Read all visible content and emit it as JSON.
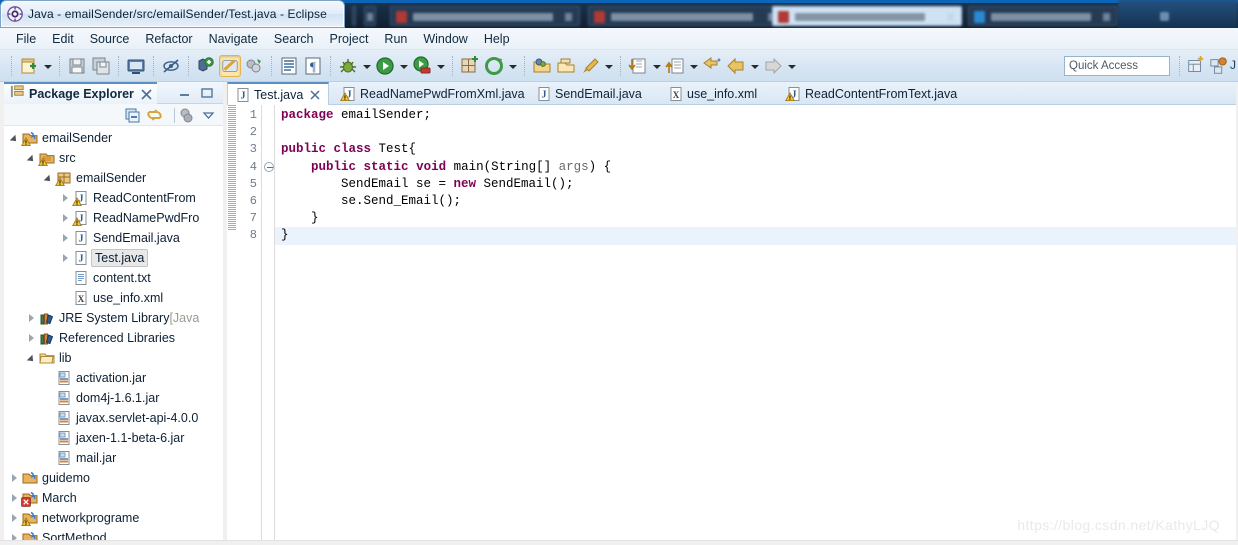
{
  "window": {
    "title": "Java - emailSender/src/emailSender/Test.java - Eclipse",
    "app_icon": "eclipse-icon"
  },
  "background": {
    "tabs": [
      {
        "name": "bg-window-tab-1"
      },
      {
        "name": "bg-window-tab-2"
      },
      {
        "name": "bg-window-tab-3"
      },
      {
        "name": "bg-window-tab-4"
      }
    ]
  },
  "menubar": {
    "items": [
      {
        "label": "File"
      },
      {
        "label": "Edit"
      },
      {
        "label": "Source"
      },
      {
        "label": "Refactor"
      },
      {
        "label": "Navigate"
      },
      {
        "label": "Search"
      },
      {
        "label": "Project"
      },
      {
        "label": "Run"
      },
      {
        "label": "Window"
      },
      {
        "label": "Help"
      }
    ]
  },
  "toolbar": {
    "buttons": [
      {
        "name": "new-wizard-button",
        "icon": "new-file-icon"
      },
      {
        "name": "save-button",
        "icon": "save-icon"
      },
      {
        "name": "save-all-button",
        "icon": "save-all-icon"
      },
      {
        "name": "print-button",
        "icon": "print-icon"
      },
      {
        "name": "toggle-mark-occurrences-button",
        "icon": "mark-occurrences-icon"
      },
      {
        "name": "new-java-class-button",
        "icon": "new-class-icon"
      },
      {
        "name": "open-type-button",
        "icon": "open-type-icon"
      },
      {
        "name": "external-tools-button",
        "icon": "external-tools-icon"
      },
      {
        "name": "toggle-block-selection-button",
        "icon": "block-selection-icon"
      },
      {
        "name": "show-whitespace-button",
        "icon": "pilcrow-icon"
      },
      {
        "name": "debug-button",
        "icon": "debug-bug-icon"
      },
      {
        "name": "run-button",
        "icon": "run-play-icon"
      },
      {
        "name": "coverage-button",
        "icon": "coverage-icon"
      },
      {
        "name": "new-annotation-button",
        "icon": "grid-plus-icon"
      },
      {
        "name": "refresh-button",
        "icon": "refresh-icon"
      },
      {
        "name": "open-task-button",
        "icon": "open-task-icon"
      },
      {
        "name": "close-task-button",
        "icon": "close-task-icon"
      },
      {
        "name": "edit-task-button",
        "icon": "brush-icon"
      },
      {
        "name": "previous-annotation-button",
        "icon": "down-arrow-doc-icon"
      },
      {
        "name": "next-annotation-button",
        "icon": "up-arrow-doc-icon"
      },
      {
        "name": "last-edit-location-button",
        "icon": "last-edit-icon"
      },
      {
        "name": "back-button",
        "icon": "back-arrow-icon"
      },
      {
        "name": "forward-button",
        "icon": "forward-arrow-icon"
      }
    ],
    "quick_access_placeholder": "Quick Access",
    "perspective_buttons": [
      {
        "name": "open-perspective-button",
        "icon": "open-perspective-icon"
      },
      {
        "name": "java-perspective-button",
        "icon": "java-perspective-icon"
      }
    ],
    "perspective_label": "J"
  },
  "package_explorer": {
    "tab_label": "Package Explorer",
    "tab_icon": "package-explorer-icon",
    "close_icon": "close-icon",
    "minimize_icon": "minimize-icon",
    "maximize_icon": "maximize-icon",
    "tools": [
      {
        "name": "collapse-all-button",
        "icon": "collapse-all-icon"
      },
      {
        "name": "link-with-editor-button",
        "icon": "link-with-editor-icon"
      },
      {
        "name": "focus-on-active-task-button",
        "icon": "focus-task-icon"
      },
      {
        "name": "view-menu-button",
        "icon": "chevron-down-icon"
      }
    ],
    "tree": [
      {
        "label": "emailSender",
        "indent": 1,
        "twisty": "expanded",
        "icon": "java-project-warning-icon",
        "selected": false
      },
      {
        "label": "src",
        "indent": 2,
        "twisty": "expanded",
        "icon": "source-folder-warning-icon",
        "selected": false
      },
      {
        "label": "emailSender",
        "indent": 3,
        "twisty": "expanded",
        "icon": "package-warning-icon",
        "selected": false
      },
      {
        "label": "ReadContentFrom",
        "indent": 4,
        "twisty": "collapsed",
        "icon": "java-file-warning-icon",
        "selected": false
      },
      {
        "label": "ReadNamePwdFro",
        "indent": 4,
        "twisty": "collapsed",
        "icon": "java-file-warning-icon",
        "selected": false
      },
      {
        "label": "SendEmail.java",
        "indent": 4,
        "twisty": "collapsed",
        "icon": "java-file-icon",
        "selected": false
      },
      {
        "label": "Test.java",
        "indent": 4,
        "twisty": "collapsed",
        "icon": "java-file-icon",
        "selected": true
      },
      {
        "label": "content.txt",
        "indent": 4,
        "twisty": "none",
        "icon": "text-file-icon",
        "selected": false
      },
      {
        "label": "use_info.xml",
        "indent": 4,
        "twisty": "none",
        "icon": "xml-file-icon",
        "selected": false
      },
      {
        "label": "JRE System Library",
        "dim_suffix": " [Java",
        "indent": 2,
        "twisty": "collapsed",
        "icon": "library-icon",
        "selected": false
      },
      {
        "label": "Referenced Libraries",
        "indent": 2,
        "twisty": "collapsed",
        "icon": "library-icon",
        "selected": false
      },
      {
        "label": "lib",
        "indent": 2,
        "twisty": "expanded",
        "icon": "folder-icon",
        "selected": false
      },
      {
        "label": "activation.jar",
        "indent": 3,
        "twisty": "none",
        "icon": "jar-icon",
        "selected": false
      },
      {
        "label": "dom4j-1.6.1.jar",
        "indent": 3,
        "twisty": "none",
        "icon": "jar-icon",
        "selected": false
      },
      {
        "label": "javax.servlet-api-4.0.0",
        "indent": 3,
        "twisty": "none",
        "icon": "jar-icon",
        "selected": false
      },
      {
        "label": "jaxen-1.1-beta-6.jar",
        "indent": 3,
        "twisty": "none",
        "icon": "jar-icon",
        "selected": false
      },
      {
        "label": "mail.jar",
        "indent": 3,
        "twisty": "none",
        "icon": "jar-icon",
        "selected": false
      },
      {
        "label": "guidemo",
        "indent": 1,
        "twisty": "collapsed",
        "icon": "java-project-icon",
        "selected": false
      },
      {
        "label": "March",
        "indent": 1,
        "twisty": "collapsed",
        "icon": "java-project-error-icon",
        "selected": false
      },
      {
        "label": "networkprograme",
        "indent": 1,
        "twisty": "collapsed",
        "icon": "java-project-warning-icon",
        "selected": false
      },
      {
        "label": "SortMethod",
        "indent": 1,
        "twisty": "collapsed",
        "icon": "java-project-icon",
        "selected": false
      }
    ]
  },
  "editor": {
    "tabs": [
      {
        "label": "Test.java",
        "icon": "java-file-icon",
        "active": true,
        "closable": true
      },
      {
        "label": "ReadNamePwdFromXml.java",
        "icon": "java-file-warning-icon",
        "active": false,
        "closable": false
      },
      {
        "label": "SendEmail.java",
        "icon": "java-file-icon",
        "active": false,
        "closable": false
      },
      {
        "label": "use_info.xml",
        "icon": "xml-file-icon",
        "active": false,
        "closable": false
      },
      {
        "label": "ReadContentFromText.java",
        "icon": "java-file-warning-icon",
        "active": false,
        "closable": false
      }
    ],
    "line_numbers": [
      "1",
      "2",
      "3",
      "4",
      "5",
      "6",
      "7",
      "8"
    ],
    "fold_marker_line": 4,
    "current_line": 8,
    "lines": [
      {
        "n": 1,
        "tokens": [
          {
            "t": "package",
            "c": "kw"
          },
          {
            "t": " emailSender;",
            "c": "pl"
          }
        ]
      },
      {
        "n": 2,
        "tokens": [
          {
            "t": "",
            "c": "pl"
          }
        ]
      },
      {
        "n": 3,
        "tokens": [
          {
            "t": "public",
            "c": "kw"
          },
          {
            "t": " ",
            "c": "pl"
          },
          {
            "t": "class",
            "c": "kw"
          },
          {
            "t": " Test{",
            "c": "pl"
          }
        ]
      },
      {
        "n": 4,
        "tokens": [
          {
            "t": "    ",
            "c": "pl"
          },
          {
            "t": "public",
            "c": "kw"
          },
          {
            "t": " ",
            "c": "pl"
          },
          {
            "t": "static",
            "c": "kw"
          },
          {
            "t": " ",
            "c": "pl"
          },
          {
            "t": "void",
            "c": "kw"
          },
          {
            "t": " main(String[] ",
            "c": "pl"
          },
          {
            "t": "args",
            "c": "pr"
          },
          {
            "t": ") {",
            "c": "pl"
          }
        ]
      },
      {
        "n": 5,
        "tokens": [
          {
            "t": "        SendEmail se = ",
            "c": "pl"
          },
          {
            "t": "new",
            "c": "kw"
          },
          {
            "t": " SendEmail();",
            "c": "pl"
          }
        ]
      },
      {
        "n": 6,
        "tokens": [
          {
            "t": "        se.Send_Email();",
            "c": "pl"
          }
        ]
      },
      {
        "n": 7,
        "tokens": [
          {
            "t": "    }",
            "c": "pl"
          }
        ]
      },
      {
        "n": 8,
        "tokens": [
          {
            "t": "}",
            "c": "pl"
          }
        ]
      }
    ]
  },
  "watermark": {
    "text": "https://blog.csdn.net/KathyLJQ"
  },
  "colors": {
    "keyword": "#7f0055",
    "title_bar": "#e3edf8",
    "toolbar": "#d7e5f3",
    "tab_active": "#ffffff",
    "current_line": "#eaf2fb",
    "selection": "#e8e8e8"
  }
}
